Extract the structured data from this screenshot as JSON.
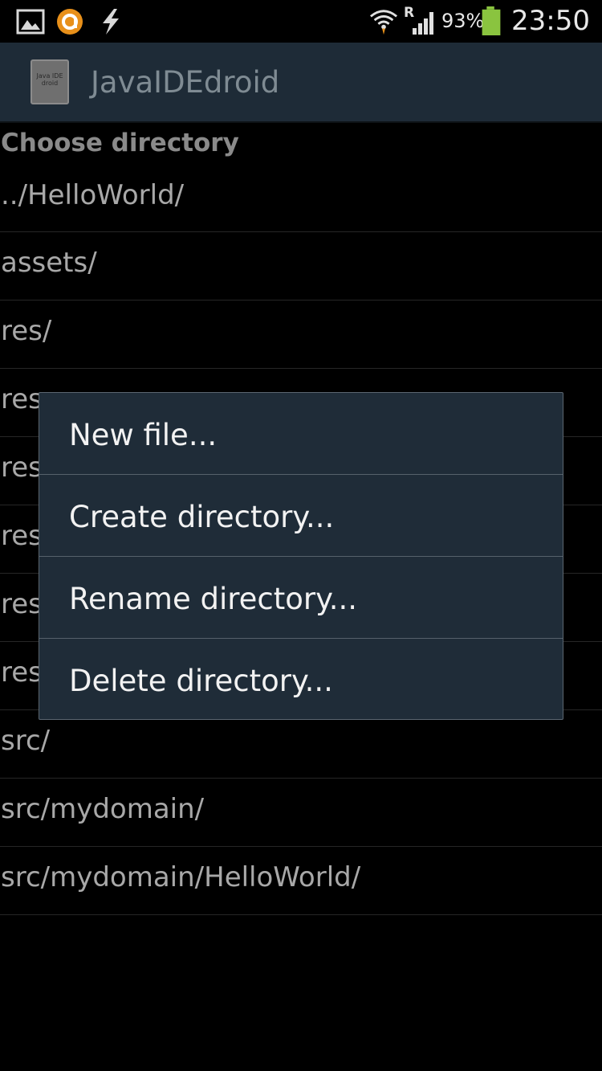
{
  "status_bar": {
    "icons": [
      "image-notification-icon",
      "avast-icon",
      "usb-debug-icon",
      "wifi-icon",
      "roaming-signal-icon",
      "battery-icon"
    ],
    "roaming_indicator": "R",
    "battery_percent": "93%",
    "time": "23:50",
    "battery_color": "#8ac43f",
    "notification_accent": "#e8901a"
  },
  "action_bar": {
    "app_icon_text": "Java IDE droid",
    "title": "JavaIDEdroid"
  },
  "content": {
    "header": "Choose directory",
    "directories": [
      "../HelloWorld/",
      "assets/",
      "res/",
      "res",
      "res",
      "res",
      "res",
      "res",
      "src/",
      "src/mydomain/",
      "src/mydomain/HelloWorld/"
    ]
  },
  "context_menu": {
    "items": [
      "New file...",
      "Create directory...",
      "Rename directory...",
      "Delete directory..."
    ]
  }
}
